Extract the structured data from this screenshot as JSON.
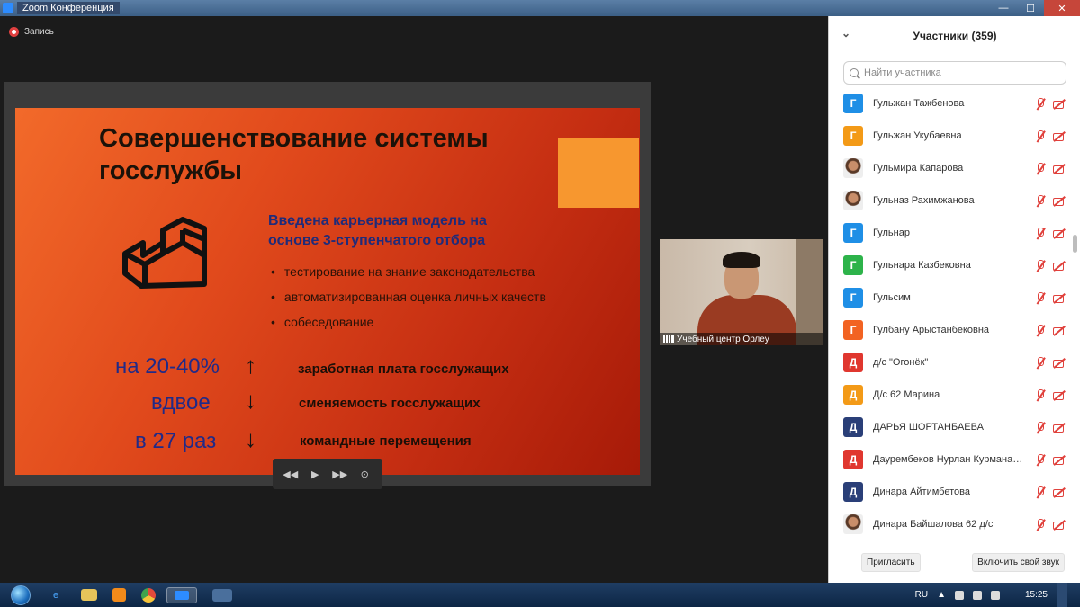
{
  "window": {
    "title": "Zoom Конференция"
  },
  "recording": {
    "label": "Запись"
  },
  "slide": {
    "title_line1": "Совершенствование системы",
    "title_line2": "госслужбы",
    "subhead_line1": "Введена карьерная модель на",
    "subhead_line2": "основе 3-ступенчатого отбора",
    "bullets": [
      "тестирование на знание законодательства",
      "автоматизированная оценка личных качеств",
      "собеседование"
    ],
    "stats": [
      {
        "value": "на 20-40%",
        "arrow": "↑",
        "desc": "заработная плата госслужащих"
      },
      {
        "value": "вдвое",
        "arrow": "↓",
        "desc": "сменяемость госслужащих"
      },
      {
        "value": "в 27 раз",
        "arrow": "↓",
        "desc": "командные перемещения"
      }
    ]
  },
  "slide_controls": {
    "prev": "◀◀",
    "play": "▶",
    "next": "▶▶",
    "settings": "⊙"
  },
  "video": {
    "name": "Учебный центр Орлеу"
  },
  "participants": {
    "header": "Участники (359)",
    "search_placeholder": "Найти участника",
    "list": [
      {
        "initial": "Г",
        "name": "Гульжан Тажбенова",
        "color": "#1f8fe6",
        "photo": false
      },
      {
        "initial": "Г",
        "name": "Гульжан Укубаевна",
        "color": "#f39a17",
        "photo": false
      },
      {
        "initial": "",
        "name": "Гульмира Капарова",
        "color": "#eeeeee",
        "photo": true
      },
      {
        "initial": "",
        "name": "Гульназ Рахимжанова",
        "color": "#eeeeee",
        "photo": true
      },
      {
        "initial": "Г",
        "name": "Гульнар",
        "color": "#1f8fe6",
        "photo": false
      },
      {
        "initial": "Г",
        "name": "Гульнара Казбековна",
        "color": "#2db34a",
        "photo": false
      },
      {
        "initial": "Г",
        "name": "Гульсим",
        "color": "#1f8fe6",
        "photo": false
      },
      {
        "initial": "Г",
        "name": "Гулбану Арыстанбековна",
        "color": "#f26322",
        "photo": false
      },
      {
        "initial": "Д",
        "name": "д/с \"Огонёк\"",
        "color": "#e0372f",
        "photo": false
      },
      {
        "initial": "Д",
        "name": "Д/с 62 Марина",
        "color": "#f39a17",
        "photo": false
      },
      {
        "initial": "Д",
        "name": "ДАРЬЯ ШОРТАНБАЕВА",
        "color": "#2a3f78",
        "photo": false
      },
      {
        "initial": "Д",
        "name": "Даурембеков Нурлан Курманалиевич",
        "color": "#e0372f",
        "photo": false
      },
      {
        "initial": "Д",
        "name": "Динара Айтимбетова",
        "color": "#2a3f78",
        "photo": false
      },
      {
        "initial": "",
        "name": "Динара Байшалова 62 д/с",
        "color": "#eeeeee",
        "photo": true
      }
    ],
    "invite_label": "Пригласить",
    "unmute_label": "Включить свой звук"
  },
  "taskbar": {
    "lang": "RU",
    "time": "15:25"
  }
}
